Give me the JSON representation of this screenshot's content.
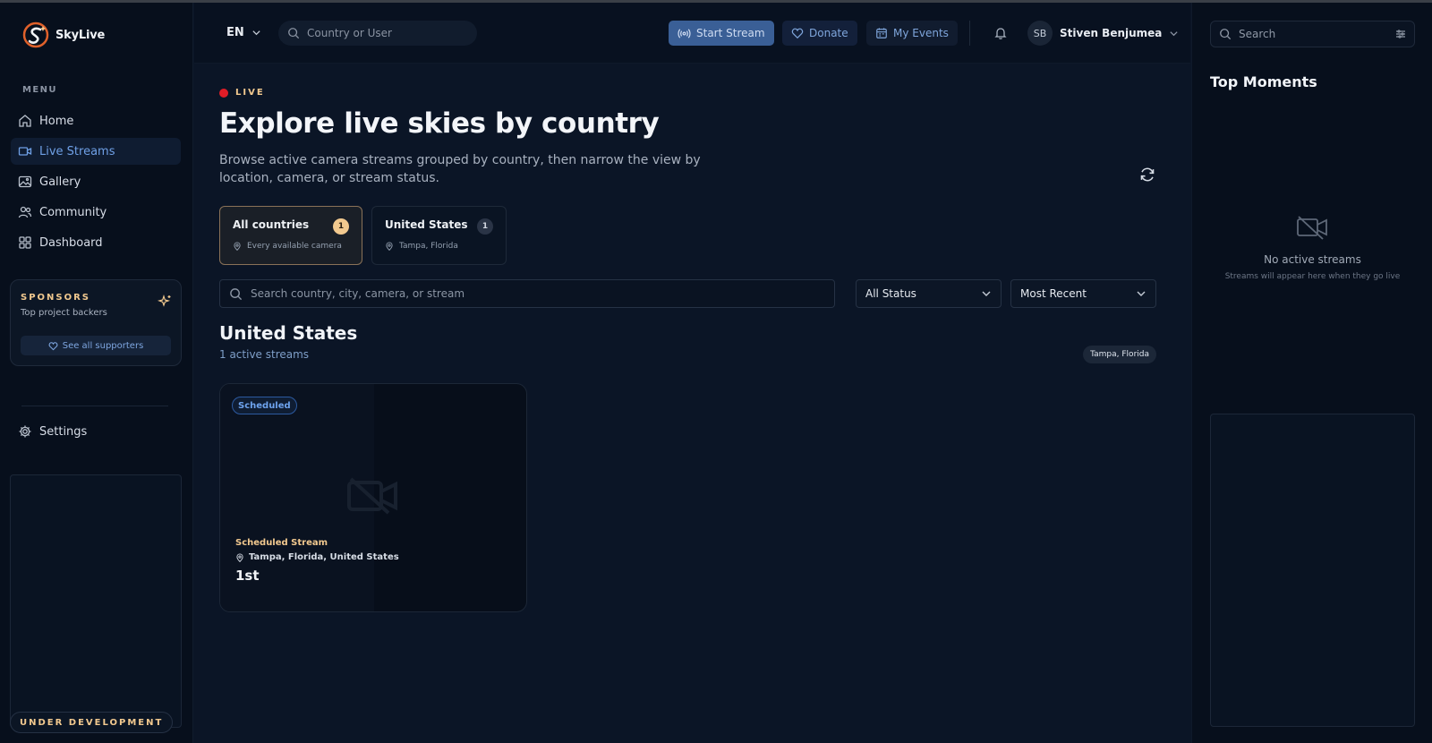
{
  "app": {
    "name": "SkyLive"
  },
  "sidebar": {
    "menu_title": "MENU",
    "items": [
      {
        "label": "Home",
        "icon": "home-icon"
      },
      {
        "label": "Live Streams",
        "icon": "video-icon",
        "active": true
      },
      {
        "label": "Gallery",
        "icon": "image-icon"
      },
      {
        "label": "Community",
        "icon": "users-icon"
      },
      {
        "label": "Dashboard",
        "icon": "grid-icon"
      }
    ],
    "sponsors": {
      "title": "SPONSORS",
      "subtitle": "Top project backers",
      "see_all": "See all supporters"
    },
    "settings_label": "Settings",
    "dev_badge": "UNDER DEVELOPMENT"
  },
  "topbar": {
    "lang": "EN",
    "search_placeholder": "Country or User",
    "start_stream": "Start Stream",
    "donate": "Donate",
    "my_events": "My Events",
    "user_initials": "SB",
    "user_name": "Stiven Benjumea"
  },
  "main": {
    "live_label": "LIVE",
    "title": "Explore live skies by country",
    "description": "Browse active camera streams grouped by country, then narrow the view by location, camera, or stream status.",
    "countries": [
      {
        "name": "All countries",
        "count": "1",
        "sub": "Every available camera"
      },
      {
        "name": "United States",
        "count": "1",
        "sub": "Tampa, Florida"
      }
    ],
    "filter_placeholder": "Search country, city, camera, or stream",
    "status_select": "All Status",
    "sort_select": "Most Recent",
    "section": {
      "title": "United States",
      "count": "1 active streams",
      "chip": "Tampa, Florida"
    },
    "stream": {
      "badge": "Scheduled",
      "type": "Scheduled Stream",
      "location": "Tampa, Florida, United States",
      "title": "1st"
    }
  },
  "right": {
    "search_placeholder": "Search",
    "title": "Top Moments",
    "empty_title": "No active streams",
    "empty_sub": "Streams will appear here when they go live"
  },
  "colors": {
    "background": "#0b1526",
    "accent_gold": "#f2c98f",
    "accent_blue": "#6fa0e6",
    "live_red": "#e11d27"
  }
}
